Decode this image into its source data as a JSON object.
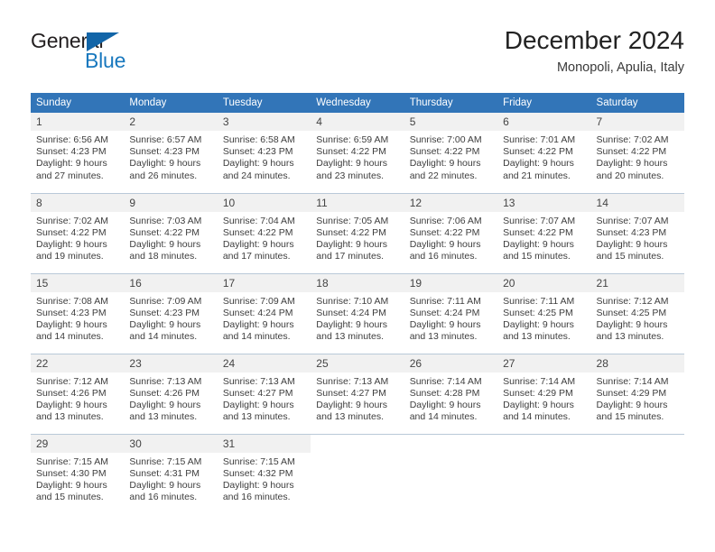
{
  "logo": {
    "word_one": "General",
    "word_two": "Blue",
    "triangle_icon": "triangle-icon",
    "accent_color": "#1265a8",
    "text_color": "#1878be"
  },
  "header": {
    "title": "December 2024",
    "subtitle": "Monopoli, Apulia, Italy",
    "header_bg_color": "#3275b8",
    "daynum_bg_color": "#f1f1f1"
  },
  "weekdays": [
    "Sunday",
    "Monday",
    "Tuesday",
    "Wednesday",
    "Thursday",
    "Friday",
    "Saturday"
  ],
  "weeks": [
    [
      {
        "day": "1",
        "sunrise": "Sunrise: 6:56 AM",
        "sunset": "Sunset: 4:23 PM",
        "daylight_line1": "Daylight: 9 hours",
        "daylight_line2": "and 27 minutes."
      },
      {
        "day": "2",
        "sunrise": "Sunrise: 6:57 AM",
        "sunset": "Sunset: 4:23 PM",
        "daylight_line1": "Daylight: 9 hours",
        "daylight_line2": "and 26 minutes."
      },
      {
        "day": "3",
        "sunrise": "Sunrise: 6:58 AM",
        "sunset": "Sunset: 4:23 PM",
        "daylight_line1": "Daylight: 9 hours",
        "daylight_line2": "and 24 minutes."
      },
      {
        "day": "4",
        "sunrise": "Sunrise: 6:59 AM",
        "sunset": "Sunset: 4:22 PM",
        "daylight_line1": "Daylight: 9 hours",
        "daylight_line2": "and 23 minutes."
      },
      {
        "day": "5",
        "sunrise": "Sunrise: 7:00 AM",
        "sunset": "Sunset: 4:22 PM",
        "daylight_line1": "Daylight: 9 hours",
        "daylight_line2": "and 22 minutes."
      },
      {
        "day": "6",
        "sunrise": "Sunrise: 7:01 AM",
        "sunset": "Sunset: 4:22 PM",
        "daylight_line1": "Daylight: 9 hours",
        "daylight_line2": "and 21 minutes."
      },
      {
        "day": "7",
        "sunrise": "Sunrise: 7:02 AM",
        "sunset": "Sunset: 4:22 PM",
        "daylight_line1": "Daylight: 9 hours",
        "daylight_line2": "and 20 minutes."
      }
    ],
    [
      {
        "day": "8",
        "sunrise": "Sunrise: 7:02 AM",
        "sunset": "Sunset: 4:22 PM",
        "daylight_line1": "Daylight: 9 hours",
        "daylight_line2": "and 19 minutes."
      },
      {
        "day": "9",
        "sunrise": "Sunrise: 7:03 AM",
        "sunset": "Sunset: 4:22 PM",
        "daylight_line1": "Daylight: 9 hours",
        "daylight_line2": "and 18 minutes."
      },
      {
        "day": "10",
        "sunrise": "Sunrise: 7:04 AM",
        "sunset": "Sunset: 4:22 PM",
        "daylight_line1": "Daylight: 9 hours",
        "daylight_line2": "and 17 minutes."
      },
      {
        "day": "11",
        "sunrise": "Sunrise: 7:05 AM",
        "sunset": "Sunset: 4:22 PM",
        "daylight_line1": "Daylight: 9 hours",
        "daylight_line2": "and 17 minutes."
      },
      {
        "day": "12",
        "sunrise": "Sunrise: 7:06 AM",
        "sunset": "Sunset: 4:22 PM",
        "daylight_line1": "Daylight: 9 hours",
        "daylight_line2": "and 16 minutes."
      },
      {
        "day": "13",
        "sunrise": "Sunrise: 7:07 AM",
        "sunset": "Sunset: 4:22 PM",
        "daylight_line1": "Daylight: 9 hours",
        "daylight_line2": "and 15 minutes."
      },
      {
        "day": "14",
        "sunrise": "Sunrise: 7:07 AM",
        "sunset": "Sunset: 4:23 PM",
        "daylight_line1": "Daylight: 9 hours",
        "daylight_line2": "and 15 minutes."
      }
    ],
    [
      {
        "day": "15",
        "sunrise": "Sunrise: 7:08 AM",
        "sunset": "Sunset: 4:23 PM",
        "daylight_line1": "Daylight: 9 hours",
        "daylight_line2": "and 14 minutes."
      },
      {
        "day": "16",
        "sunrise": "Sunrise: 7:09 AM",
        "sunset": "Sunset: 4:23 PM",
        "daylight_line1": "Daylight: 9 hours",
        "daylight_line2": "and 14 minutes."
      },
      {
        "day": "17",
        "sunrise": "Sunrise: 7:09 AM",
        "sunset": "Sunset: 4:24 PM",
        "daylight_line1": "Daylight: 9 hours",
        "daylight_line2": "and 14 minutes."
      },
      {
        "day": "18",
        "sunrise": "Sunrise: 7:10 AM",
        "sunset": "Sunset: 4:24 PM",
        "daylight_line1": "Daylight: 9 hours",
        "daylight_line2": "and 13 minutes."
      },
      {
        "day": "19",
        "sunrise": "Sunrise: 7:11 AM",
        "sunset": "Sunset: 4:24 PM",
        "daylight_line1": "Daylight: 9 hours",
        "daylight_line2": "and 13 minutes."
      },
      {
        "day": "20",
        "sunrise": "Sunrise: 7:11 AM",
        "sunset": "Sunset: 4:25 PM",
        "daylight_line1": "Daylight: 9 hours",
        "daylight_line2": "and 13 minutes."
      },
      {
        "day": "21",
        "sunrise": "Sunrise: 7:12 AM",
        "sunset": "Sunset: 4:25 PM",
        "daylight_line1": "Daylight: 9 hours",
        "daylight_line2": "and 13 minutes."
      }
    ],
    [
      {
        "day": "22",
        "sunrise": "Sunrise: 7:12 AM",
        "sunset": "Sunset: 4:26 PM",
        "daylight_line1": "Daylight: 9 hours",
        "daylight_line2": "and 13 minutes."
      },
      {
        "day": "23",
        "sunrise": "Sunrise: 7:13 AM",
        "sunset": "Sunset: 4:26 PM",
        "daylight_line1": "Daylight: 9 hours",
        "daylight_line2": "and 13 minutes."
      },
      {
        "day": "24",
        "sunrise": "Sunrise: 7:13 AM",
        "sunset": "Sunset: 4:27 PM",
        "daylight_line1": "Daylight: 9 hours",
        "daylight_line2": "and 13 minutes."
      },
      {
        "day": "25",
        "sunrise": "Sunrise: 7:13 AM",
        "sunset": "Sunset: 4:27 PM",
        "daylight_line1": "Daylight: 9 hours",
        "daylight_line2": "and 13 minutes."
      },
      {
        "day": "26",
        "sunrise": "Sunrise: 7:14 AM",
        "sunset": "Sunset: 4:28 PM",
        "daylight_line1": "Daylight: 9 hours",
        "daylight_line2": "and 14 minutes."
      },
      {
        "day": "27",
        "sunrise": "Sunrise: 7:14 AM",
        "sunset": "Sunset: 4:29 PM",
        "daylight_line1": "Daylight: 9 hours",
        "daylight_line2": "and 14 minutes."
      },
      {
        "day": "28",
        "sunrise": "Sunrise: 7:14 AM",
        "sunset": "Sunset: 4:29 PM",
        "daylight_line1": "Daylight: 9 hours",
        "daylight_line2": "and 15 minutes."
      }
    ],
    [
      {
        "day": "29",
        "sunrise": "Sunrise: 7:15 AM",
        "sunset": "Sunset: 4:30 PM",
        "daylight_line1": "Daylight: 9 hours",
        "daylight_line2": "and 15 minutes."
      },
      {
        "day": "30",
        "sunrise": "Sunrise: 7:15 AM",
        "sunset": "Sunset: 4:31 PM",
        "daylight_line1": "Daylight: 9 hours",
        "daylight_line2": "and 16 minutes."
      },
      {
        "day": "31",
        "sunrise": "Sunrise: 7:15 AM",
        "sunset": "Sunset: 4:32 PM",
        "daylight_line1": "Daylight: 9 hours",
        "daylight_line2": "and 16 minutes."
      },
      {
        "day": "",
        "sunrise": "",
        "sunset": "",
        "daylight_line1": "",
        "daylight_line2": ""
      },
      {
        "day": "",
        "sunrise": "",
        "sunset": "",
        "daylight_line1": "",
        "daylight_line2": ""
      },
      {
        "day": "",
        "sunrise": "",
        "sunset": "",
        "daylight_line1": "",
        "daylight_line2": ""
      },
      {
        "day": "",
        "sunrise": "",
        "sunset": "",
        "daylight_line1": "",
        "daylight_line2": ""
      }
    ]
  ]
}
